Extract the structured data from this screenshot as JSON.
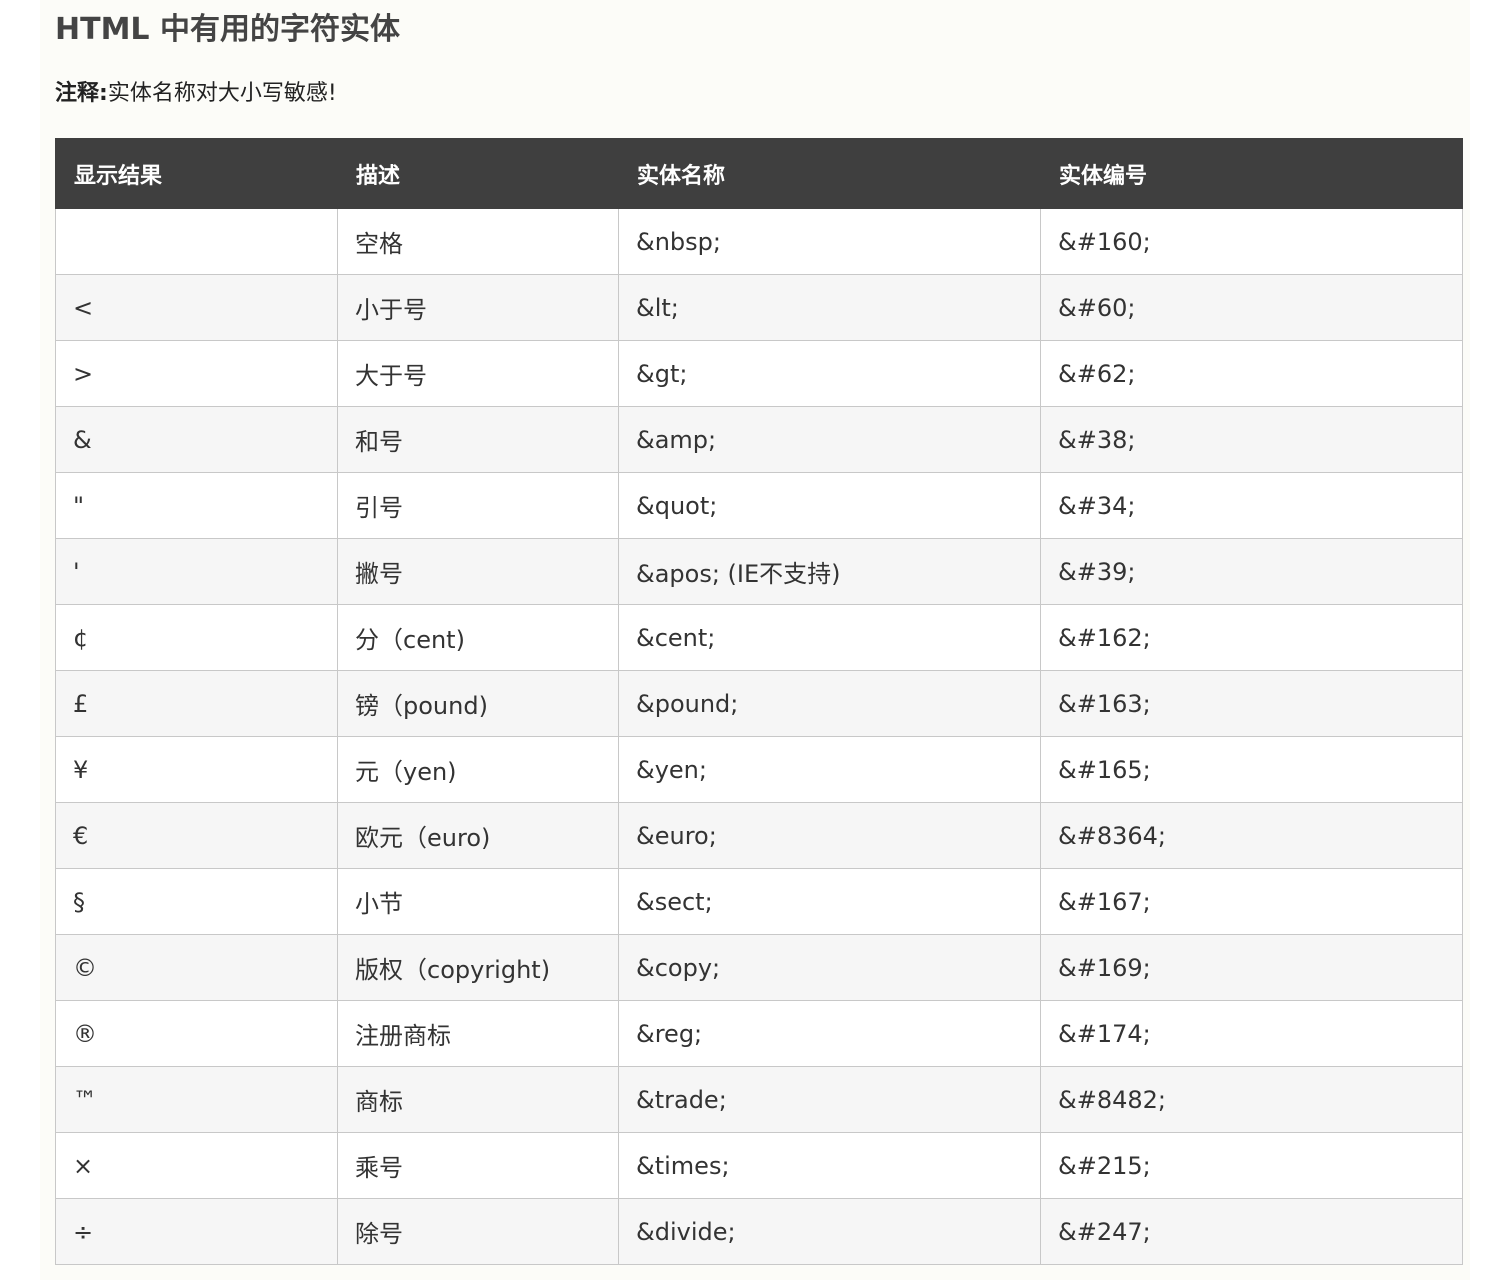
{
  "title": "HTML 中有用的字符实体",
  "note": {
    "label": "注释:",
    "text": "实体名称对大小写敏感!"
  },
  "table": {
    "headers": [
      "显示结果",
      "描述",
      "实体名称",
      "实体编号"
    ],
    "rows": [
      {
        "result": "",
        "description": "空格",
        "entity_name": "&nbsp;",
        "entity_number": "&#160;"
      },
      {
        "result": "<",
        "description": "小于号",
        "entity_name": "&lt;",
        "entity_number": "&#60;"
      },
      {
        "result": ">",
        "description": "大于号",
        "entity_name": "&gt;",
        "entity_number": "&#62;"
      },
      {
        "result": "&",
        "description": "和号",
        "entity_name": "&amp;",
        "entity_number": "&#38;"
      },
      {
        "result": "\"",
        "description": "引号",
        "entity_name": "&quot;",
        "entity_number": "&#34;"
      },
      {
        "result": "'",
        "description": "撇号",
        "entity_name": "&apos; (IE不支持)",
        "entity_number": "&#39;"
      },
      {
        "result": "¢",
        "description": "分（cent)",
        "entity_name": "&cent;",
        "entity_number": "&#162;"
      },
      {
        "result": "£",
        "description": "镑（pound)",
        "entity_name": "&pound;",
        "entity_number": "&#163;"
      },
      {
        "result": "¥",
        "description": "元（yen)",
        "entity_name": "&yen;",
        "entity_number": "&#165;"
      },
      {
        "result": "€",
        "description": "欧元（euro)",
        "entity_name": "&euro;",
        "entity_number": "&#8364;"
      },
      {
        "result": "§",
        "description": "小节",
        "entity_name": "&sect;",
        "entity_number": "&#167;"
      },
      {
        "result": "©",
        "description": "版权（copyright)",
        "entity_name": "&copy;",
        "entity_number": "&#169;"
      },
      {
        "result": "®",
        "description": "注册商标",
        "entity_name": "&reg;",
        "entity_number": "&#174;"
      },
      {
        "result": "™",
        "description": "商标",
        "entity_name": "&trade;",
        "entity_number": "&#8482;"
      },
      {
        "result": "×",
        "description": "乘号",
        "entity_name": "&times;",
        "entity_number": "&#215;"
      },
      {
        "result": "÷",
        "description": "除号",
        "entity_name": "&divide;",
        "entity_number": "&#247;"
      }
    ]
  }
}
